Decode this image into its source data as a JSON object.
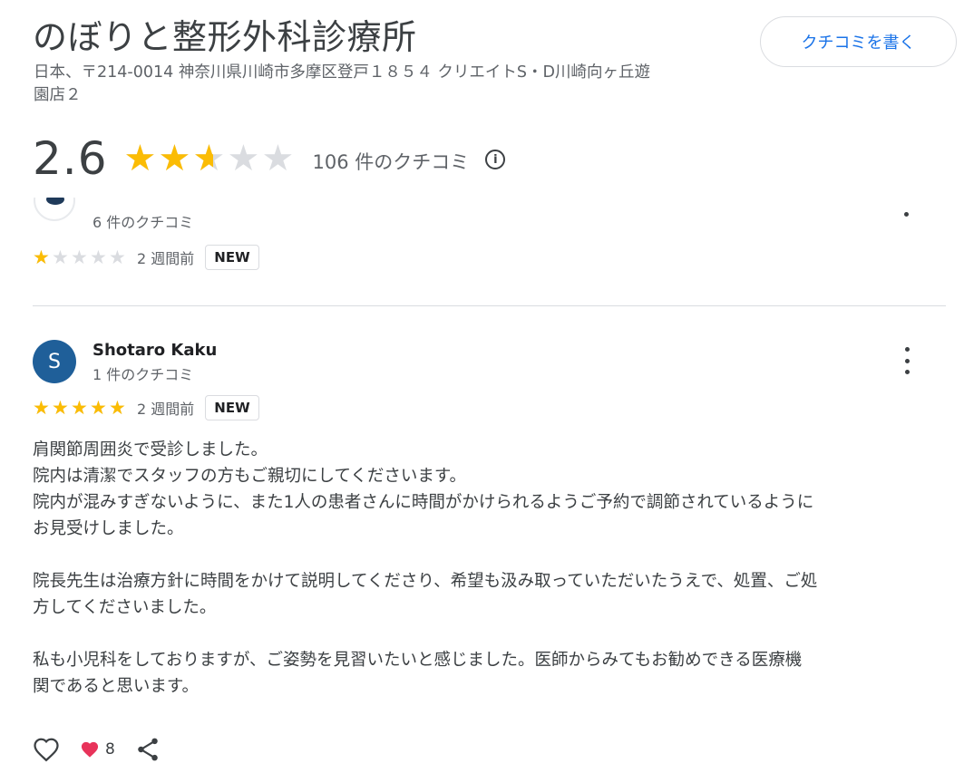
{
  "place": {
    "name": "のぼりと整形外科診療所",
    "address_line1": "日本、〒214-0014 神奈川県川崎市多摩区登戸１８５４ クリエイトS・D川崎向ヶ丘遊",
    "address_line2": "園店２",
    "write_review_label": "クチコミを書く"
  },
  "summary": {
    "rating": "2.6",
    "rating_value": 2.6,
    "review_count_label": "106 件のクチコミ",
    "info_icon": "info-icon"
  },
  "previous_review": {
    "reviewer_count_label": "6 件のクチコミ",
    "stars": 1,
    "time_label": "2 週間前",
    "badge": "NEW"
  },
  "review": {
    "avatar_letter": "S",
    "avatar_color": "#1f5f99",
    "reviewer_name": "Shotaro Kaku",
    "reviewer_count_label": "1 件のクチコミ",
    "stars": 5,
    "time_label": "2 週間前",
    "badge": "NEW",
    "text": {
      "p1_l1": "肩関節周囲炎で受診しました。",
      "p1_l2": "院内は清潔でスタッフの方もご親切にしてくださいます。",
      "p1_l3": "院内が混みすぎないように、また1人の患者さんに時間がかけられるようご予約で調節されているように",
      "p1_l4": "お見受けしました。",
      "p2_l1": "院長先生は治療方針に時間をかけて説明してくださり、希望も汲み取っていただいたうえで、処置、ご処",
      "p2_l2": "方してくださいました。",
      "p3_l1": "私も小児科をしておりますが、ご姿勢を見習いたいと感じました。医師からみてもお勧めできる医療機",
      "p3_l2": "関であると思います。"
    },
    "reaction_count": "8"
  },
  "colors": {
    "star_filled": "#fbbc04",
    "star_empty": "#dadce0",
    "accent": "#1a73e8",
    "heart": "#e8335a"
  }
}
